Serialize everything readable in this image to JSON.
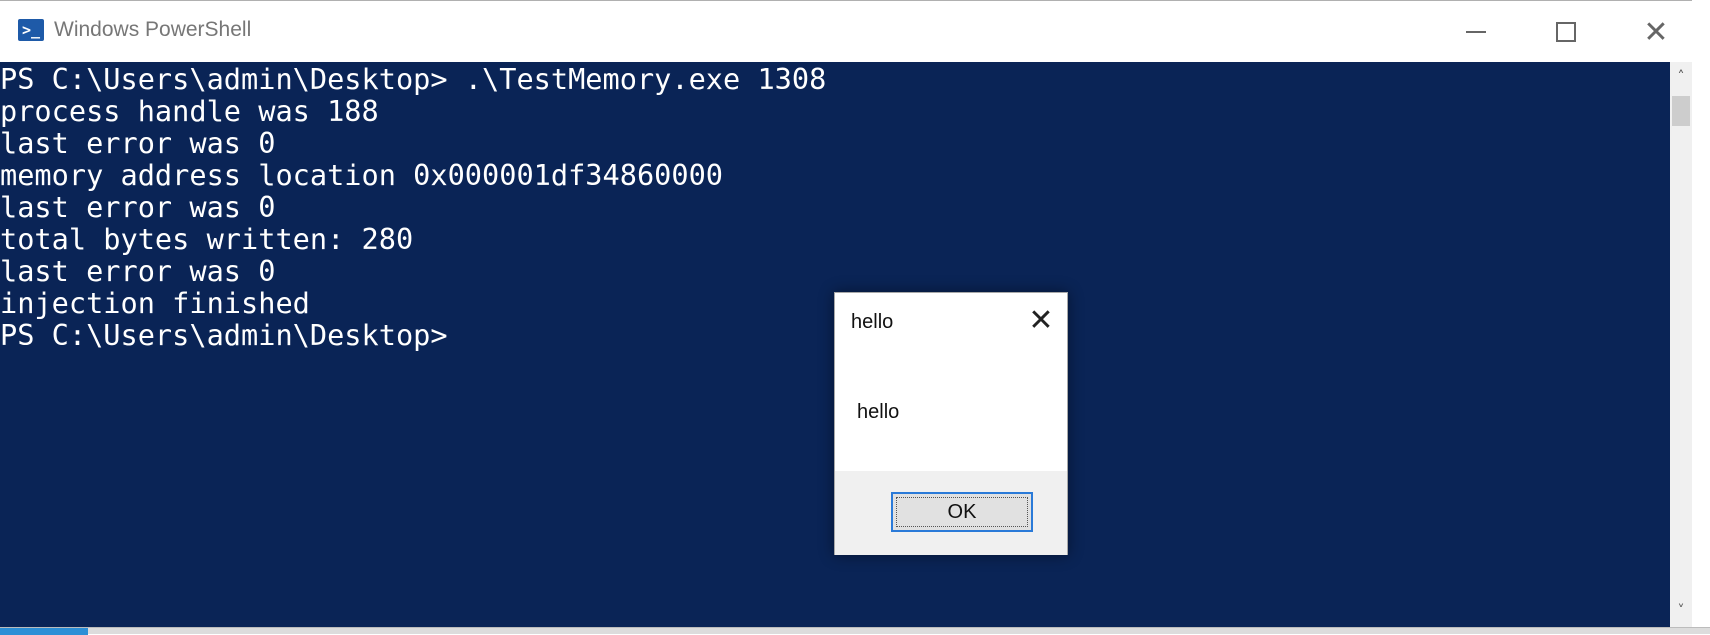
{
  "window": {
    "title": "Windows PowerShell",
    "app_icon_glyph": ">_",
    "controls": {
      "minimize_icon": "minimize-icon",
      "maximize_icon": "maximize-icon",
      "close_icon": "close-icon",
      "close_glyph": "✕"
    }
  },
  "console": {
    "background": "#0a2456",
    "foreground": "#ffffff",
    "lines": [
      "PS C:\\Users\\admin\\Desktop> .\\TestMemory.exe 1308",
      "process handle was 188",
      "last error was 0",
      "memory address location 0x000001df34860000",
      "last error was 0",
      "total bytes written: 280",
      "last error was 0",
      "injection finished",
      "PS C:\\Users\\admin\\Desktop>"
    ]
  },
  "scrollbar": {
    "up_glyph": "˄",
    "down_glyph": "˅"
  },
  "dialog": {
    "title": "hello",
    "message": "hello",
    "close_glyph": "✕",
    "ok_label": "OK",
    "accent": "#2a7ad8"
  }
}
